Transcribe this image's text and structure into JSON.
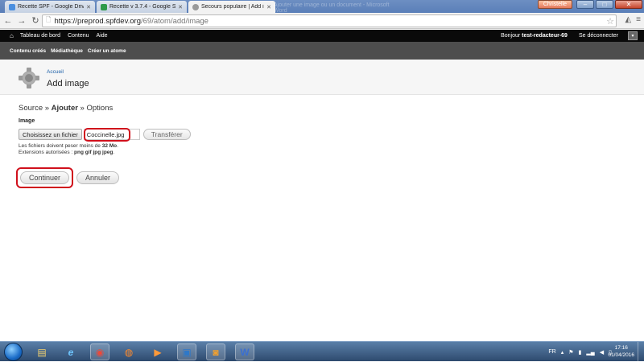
{
  "browser": {
    "tabs": [
      {
        "label": "Recette SPF - Google Driv",
        "icon_color": "#4a8fe0",
        "active": false
      },
      {
        "label": "Recette v 3.7.4 - Google S",
        "icon_color": "#2e9a4a",
        "active": false
      },
      {
        "label": "Secours populaire | Add im",
        "icon_color": "#9a9a9a",
        "active": true
      }
    ],
    "ghost_tab": "Ajouter une image ou un document - Microsoft Word",
    "user_chip": "Christelle",
    "url_host": "https://preprod.spfdev.org",
    "url_path": "/69/atom/add/image"
  },
  "admin_bar": {
    "home_icon": "home-icon",
    "links": [
      "Tableau de bord",
      "Contenu",
      "Aide"
    ],
    "greeting_prefix": "Bonjour ",
    "username": "test-redacteur-69",
    "logout": "Se déconnecter"
  },
  "shortcuts": [
    "Contenu créés",
    "Médiathèque",
    "Créer un atome"
  ],
  "header": {
    "breadcrumb": "Accueil",
    "title": "Add image"
  },
  "wizard": {
    "step1": "Source",
    "sep": " » ",
    "step2": "Ajouter",
    "step3": "Options"
  },
  "form": {
    "image_label": "Image",
    "choose_file": "Choisissez un fichier",
    "file_name": "Coccinelle.jpg",
    "upload": "Transférer",
    "help_size_prefix": "Les fichiers doivent peser moins de ",
    "help_size_value": "32 Mo",
    "help_size_suffix": ".",
    "help_ext_prefix": "Extensions autorisées : ",
    "help_ext_value": "png gif jpg jpeg",
    "help_ext_suffix": "."
  },
  "actions": {
    "continue": "Continuer",
    "cancel": "Annuler"
  },
  "taskbar": {
    "lang": "FR",
    "time": "17:16",
    "date": "01/04/2016"
  },
  "colors": {
    "annotation": "#d0101c",
    "link": "#1a5fa8",
    "admin_bg": "#0a0a0a",
    "shortcut_bg": "#4d4d4d"
  }
}
